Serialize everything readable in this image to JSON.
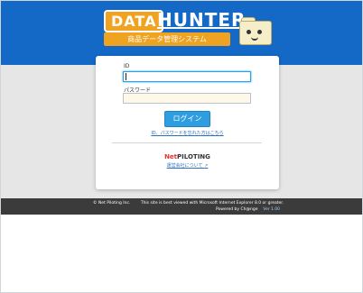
{
  "header": {
    "logo_badge": "DATA",
    "logo_word": "HUNTER",
    "logo_subtitle": "商品データ管理システム"
  },
  "login": {
    "id_label": "ID",
    "id_value": "",
    "password_label": "パスワード",
    "password_value": "",
    "button_label": "ログイン",
    "forgot_link": "ID、パスワードを忘れた方はこちら"
  },
  "partner": {
    "logo_prefix": "Net",
    "logo_rest": "PILOTING",
    "link_text": "運営会社について"
  },
  "footer": {
    "copyright": "© Net Piloting Inc.",
    "browser_note": "This site is best viewed with Microsoft Internet Explorer 8.0 or greater.",
    "powered_by": "Powered by Ch@nge",
    "version": "Ver 1.00"
  },
  "colors": {
    "header_blue": "#1469c7",
    "logo_orange": "#f0a321",
    "button_blue": "#2e9ee0",
    "footer_dark": "#3b3b3b"
  }
}
